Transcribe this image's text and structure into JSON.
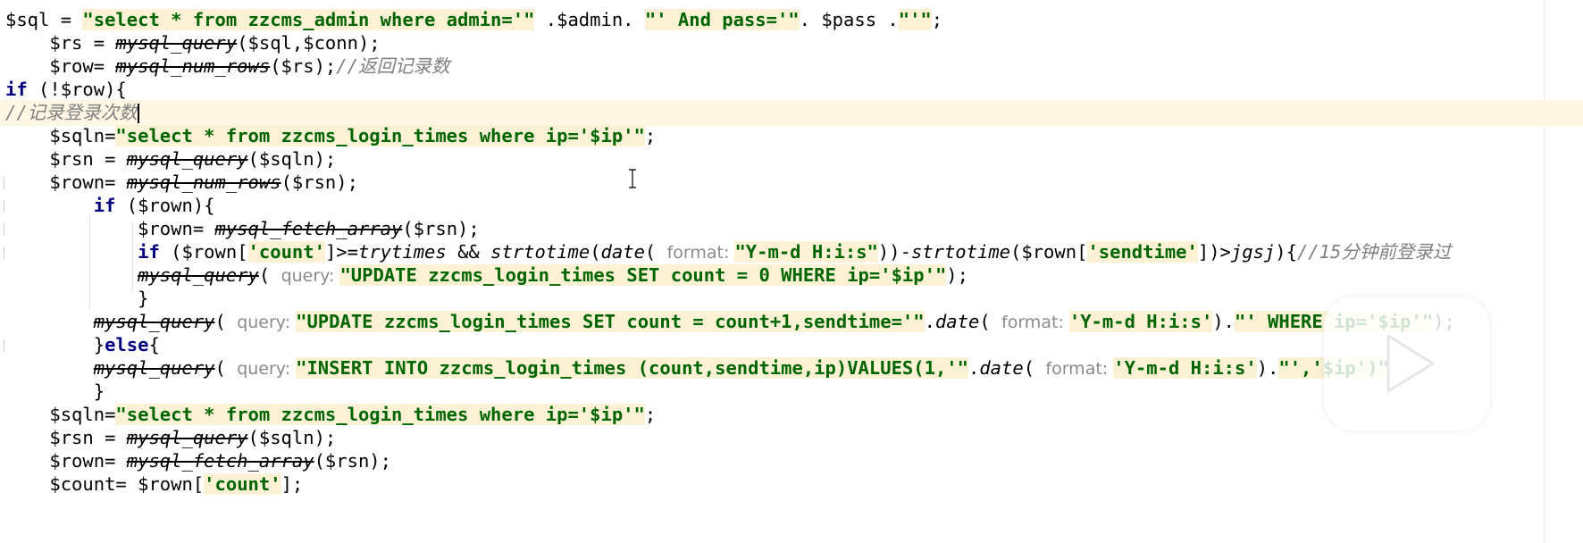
{
  "editor": {
    "language": "php",
    "colors": {
      "keyword": "#000080",
      "string": "#006400",
      "string_highlight": "#fbf2d6",
      "comment": "#808080",
      "current_line": "#fdf7e3",
      "hint": "#8a8a8a"
    },
    "current_line_index": 4,
    "lines": [
      {
        "tokens": [
          {
            "t": "var",
            "text": "$sql = "
          },
          {
            "t": "str",
            "text": "\"select * from zzcms_admin where admin='"
          },
          {
            "t": "str",
            "text": "\""
          },
          {
            "t": "plain",
            "text": " .$admin. "
          },
          {
            "t": "str",
            "text": "\"' And pass='\""
          },
          {
            "t": "plain",
            "text": ". $pass ."
          },
          {
            "t": "str",
            "text": "\"'\""
          },
          {
            "t": "plain",
            "text": ";"
          }
        ]
      },
      {
        "tokens": [
          {
            "t": "var",
            "text": "    $rs = "
          },
          {
            "t": "fn",
            "text": "mysql_query"
          },
          {
            "t": "plain",
            "text": "($sql,$conn);"
          }
        ]
      },
      {
        "tokens": [
          {
            "t": "var",
            "text": "    $row= "
          },
          {
            "t": "fn",
            "text": "mysql_num_rows"
          },
          {
            "t": "plain",
            "text": "($rs);"
          },
          {
            "t": "com",
            "text": "//返回记录数"
          }
        ]
      },
      {
        "tokens": [
          {
            "t": "kw",
            "text": "if"
          },
          {
            "t": "plain",
            "text": " (!$row){"
          }
        ]
      },
      {
        "tokens": [
          {
            "t": "com",
            "text": "//记录登录次数"
          },
          {
            "t": "cursor",
            "text": ""
          }
        ]
      },
      {
        "tokens": [
          {
            "t": "var",
            "text": "    $sqln="
          },
          {
            "t": "str",
            "text": "\"select * from zzcms_login_times where ip='$ip'\""
          },
          {
            "t": "plain",
            "text": ";"
          }
        ]
      },
      {
        "tokens": [
          {
            "t": "var",
            "text": "    $rsn = "
          },
          {
            "t": "fn",
            "text": "mysql_query"
          },
          {
            "t": "plain",
            "text": "($sqln);"
          }
        ]
      },
      {
        "tokens": [
          {
            "t": "var",
            "text": "    $rown= "
          },
          {
            "t": "fn",
            "text": "mysql_num_rows"
          },
          {
            "t": "plain",
            "text": "($rsn);"
          }
        ]
      },
      {
        "tokens": [
          {
            "t": "plain",
            "text": "        "
          },
          {
            "t": "kw",
            "text": "if"
          },
          {
            "t": "plain",
            "text": " ($rown){"
          }
        ]
      },
      {
        "tokens": [
          {
            "t": "var",
            "text": "            $rown= "
          },
          {
            "t": "fn",
            "text": "mysql_fetch_array"
          },
          {
            "t": "plain",
            "text": "($rsn);"
          }
        ]
      },
      {
        "tokens": [
          {
            "t": "plain",
            "text": "            "
          },
          {
            "t": "kw",
            "text": "if"
          },
          {
            "t": "plain",
            "text": " ($rown["
          },
          {
            "t": "str",
            "text": "'count'"
          },
          {
            "t": "plain",
            "text": "]>="
          },
          {
            "t": "ifn",
            "text": "trytimes"
          },
          {
            "t": "plain",
            "text": " && "
          },
          {
            "t": "ifn",
            "text": "strtotime"
          },
          {
            "t": "plain",
            "text": "("
          },
          {
            "t": "ifn",
            "text": "date"
          },
          {
            "t": "plain",
            "text": "( "
          },
          {
            "t": "hint",
            "text": "format: "
          },
          {
            "t": "str",
            "text": "\"Y-m-d H:i:s\""
          },
          {
            "t": "plain",
            "text": "))-"
          },
          {
            "t": "ifn",
            "text": "strtotime"
          },
          {
            "t": "plain",
            "text": "($rown["
          },
          {
            "t": "str",
            "text": "'sendtime'"
          },
          {
            "t": "plain",
            "text": "])>"
          },
          {
            "t": "ifn",
            "text": "jgsj"
          },
          {
            "t": "plain",
            "text": "){"
          },
          {
            "t": "com",
            "text": "//15分钟前登录过"
          }
        ]
      },
      {
        "tokens": [
          {
            "t": "plain",
            "text": "            "
          },
          {
            "t": "fn",
            "text": "mysql_query"
          },
          {
            "t": "plain",
            "text": "( "
          },
          {
            "t": "hint",
            "text": "query: "
          },
          {
            "t": "str",
            "text": "\"UPDATE zzcms_login_times SET count = 0 WHERE ip='$ip'\""
          },
          {
            "t": "plain",
            "text": ");"
          }
        ]
      },
      {
        "tokens": [
          {
            "t": "plain",
            "text": "            }"
          }
        ]
      },
      {
        "tokens": [
          {
            "t": "plain",
            "text": "        "
          },
          {
            "t": "fn",
            "text": "mysql_query"
          },
          {
            "t": "plain",
            "text": "( "
          },
          {
            "t": "hint",
            "text": "query: "
          },
          {
            "t": "str",
            "text": "\"UPDATE zzcms_login_times SET count = count+1,sendtime='\""
          },
          {
            "t": "plain",
            "text": "."
          },
          {
            "t": "ifn",
            "text": "date"
          },
          {
            "t": "plain",
            "text": "( "
          },
          {
            "t": "hint",
            "text": "format: "
          },
          {
            "t": "str",
            "text": "'Y-m-d H:i:s'"
          },
          {
            "t": "plain",
            "text": ")."
          },
          {
            "t": "str",
            "text": "\"' WHERE ip='$ip'\""
          },
          {
            "t": "plain",
            "text": ");"
          }
        ]
      },
      {
        "tokens": [
          {
            "t": "plain",
            "text": "        }"
          },
          {
            "t": "kw",
            "text": "else"
          },
          {
            "t": "plain",
            "text": "{"
          }
        ]
      },
      {
        "tokens": [
          {
            "t": "plain",
            "text": "        "
          },
          {
            "t": "fn",
            "text": "mysql_query"
          },
          {
            "t": "plain",
            "text": "( "
          },
          {
            "t": "hint",
            "text": "query: "
          },
          {
            "t": "str",
            "text": "\"INSERT INTO zzcms_login_times (count,sendtime,ip)VALUES(1,'\""
          },
          {
            "t": "plain",
            "text": "."
          },
          {
            "t": "ifn",
            "text": "date"
          },
          {
            "t": "plain",
            "text": "( "
          },
          {
            "t": "hint",
            "text": "format: "
          },
          {
            "t": "str",
            "text": "'Y-m-d H:i:s'"
          },
          {
            "t": "plain",
            "text": ")."
          },
          {
            "t": "str",
            "text": "\"','$ip')\""
          },
          {
            "t": "plain",
            "text": ");"
          }
        ]
      },
      {
        "tokens": [
          {
            "t": "plain",
            "text": "        }"
          }
        ]
      },
      {
        "tokens": [
          {
            "t": "var",
            "text": "    $sqln="
          },
          {
            "t": "str",
            "text": "\"select * from zzcms_login_times where ip='$ip'\""
          },
          {
            "t": "plain",
            "text": ";"
          }
        ]
      },
      {
        "tokens": [
          {
            "t": "var",
            "text": "    $rsn = "
          },
          {
            "t": "fn",
            "text": "mysql_query"
          },
          {
            "t": "plain",
            "text": "($sqln);"
          }
        ]
      },
      {
        "tokens": [
          {
            "t": "var",
            "text": "    $rown= "
          },
          {
            "t": "fn",
            "text": "mysql_fetch_array"
          },
          {
            "t": "plain",
            "text": "($rsn);"
          }
        ]
      },
      {
        "tokens": [
          {
            "t": "var",
            "text": "    $count= $rown["
          },
          {
            "t": "str",
            "text": "'count'"
          },
          {
            "t": "plain",
            "text": "];"
          }
        ]
      }
    ]
  },
  "overlay": {
    "play_icon": "play-icon",
    "text_cursor_icon": "i-beam-cursor-icon"
  }
}
